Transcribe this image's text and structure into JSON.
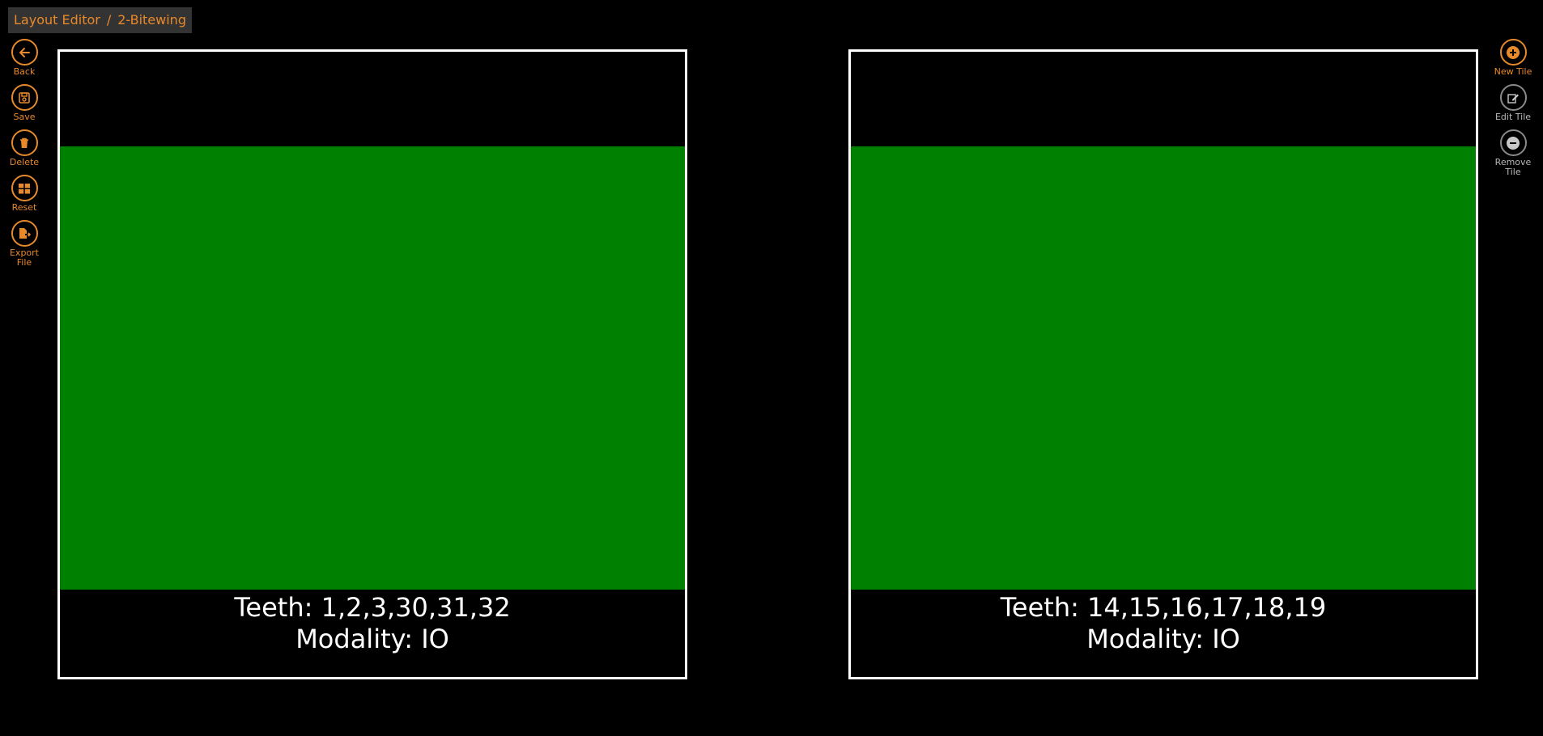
{
  "breadcrumb": {
    "root": "Layout Editor",
    "separator": "/",
    "current": "2-Bitewing"
  },
  "left_toolbar": [
    {
      "label": "Back",
      "icon": "arrow-left-icon"
    },
    {
      "label": "Save",
      "icon": "save-icon"
    },
    {
      "label": "Delete",
      "icon": "trash-icon"
    },
    {
      "label": "Reset",
      "icon": "grid-icon"
    },
    {
      "label": "Export File",
      "icon": "export-file-icon"
    }
  ],
  "right_toolbar": [
    {
      "label": "New Tile",
      "icon": "plus-circle-icon",
      "enabled": true
    },
    {
      "label": "Edit Tile",
      "icon": "edit-icon",
      "enabled": false
    },
    {
      "label": "Remove Tile",
      "icon": "minus-circle-icon",
      "enabled": false
    }
  ],
  "tiles": [
    {
      "teeth": "Teeth: 1,2,3,30,31,32",
      "modality": "Modality: IO",
      "color": "#008000"
    },
    {
      "teeth": "Teeth: 14,15,16,17,18,19",
      "modality": "Modality: IO",
      "color": "#008000"
    }
  ],
  "colors": {
    "accent": "#e8892a",
    "tile_fill": "#008000",
    "tile_border": "#ffffff",
    "background": "#000000",
    "disabled": "#8a8a8a"
  }
}
